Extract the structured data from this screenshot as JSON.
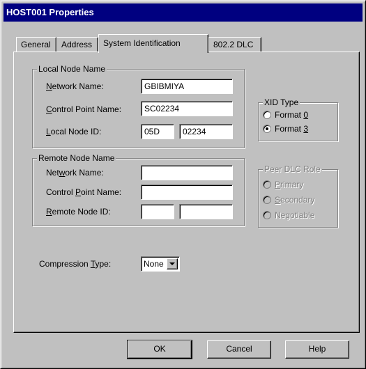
{
  "window": {
    "title": "HOST001 Properties"
  },
  "tabs": [
    {
      "label": "General"
    },
    {
      "label": "Address"
    },
    {
      "label": "System Identification"
    },
    {
      "label": "802.2 DLC"
    }
  ],
  "local_node": {
    "group_label": "Local Node Name",
    "network_name_label": {
      "pre": "",
      "key": "N",
      "post": "etwork Name:"
    },
    "network_name_value": "GBIBMIYA",
    "control_point_label": {
      "pre": "",
      "key": "C",
      "post": "ontrol Point Name:"
    },
    "control_point_value": "SC02234",
    "node_id_label": {
      "pre": "",
      "key": "L",
      "post": "ocal Node ID:"
    },
    "node_id_block": "05D",
    "node_id_num": "02234"
  },
  "xid_type": {
    "group_label": "XID Type",
    "options": [
      {
        "pre": "Format ",
        "key": "0",
        "post": "",
        "selected": false
      },
      {
        "pre": "Format ",
        "key": "3",
        "post": "",
        "selected": true
      }
    ]
  },
  "remote_node": {
    "group_label": "Remote Node Name",
    "network_name_label": {
      "pre": "Net",
      "key": "w",
      "post": "ork Name:"
    },
    "network_name_value": "",
    "control_point_label": {
      "pre": "Control ",
      "key": "P",
      "post": "oint Name:"
    },
    "control_point_value": "",
    "node_id_label": {
      "pre": "",
      "key": "R",
      "post": "emote Node ID:"
    },
    "node_id_block": "",
    "node_id_num": ""
  },
  "peer_dlc_role": {
    "group_label": "Peer DLC Role",
    "options": [
      {
        "pre": "",
        "key": "P",
        "post": "rimary"
      },
      {
        "pre": "",
        "key": "S",
        "post": "econdary"
      },
      {
        "pre": "Ne",
        "key": "g",
        "post": "otiable"
      }
    ]
  },
  "compression": {
    "label": {
      "pre": "Compression ",
      "key": "T",
      "post": "ype:"
    },
    "value": "None"
  },
  "buttons": {
    "ok": "OK",
    "cancel": "Cancel",
    "help": "Help"
  }
}
